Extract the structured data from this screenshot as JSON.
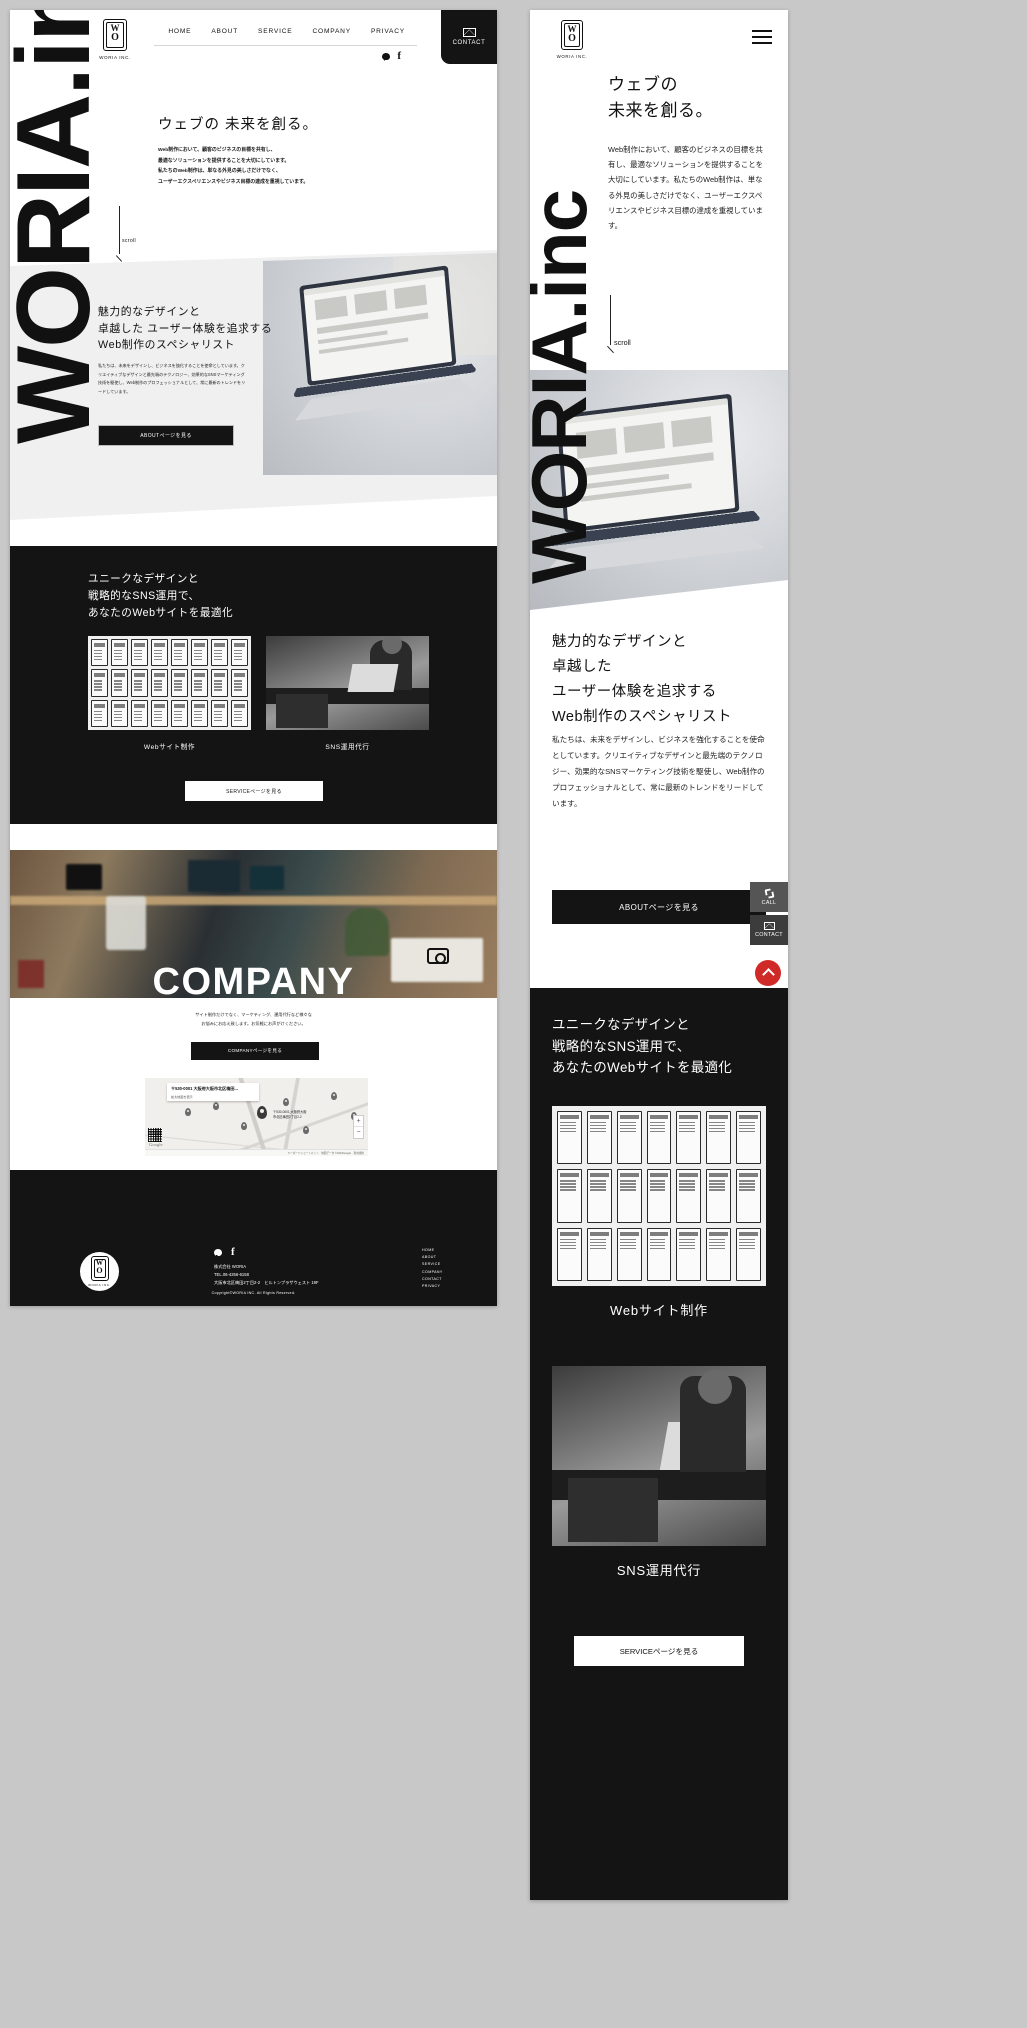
{
  "brand": {
    "wordmark": "WORIA.inc",
    "logo_letters_top": "W",
    "logo_letters_bottom": "O",
    "logo_caption": "WORIA INC."
  },
  "header": {
    "nav": [
      {
        "label": "HOME"
      },
      {
        "label": "ABOUT"
      },
      {
        "label": "SERVICE"
      },
      {
        "label": "COMPANY"
      },
      {
        "label": "PRIVACY"
      }
    ],
    "social": [
      {
        "name": "line-icon"
      },
      {
        "name": "facebook-icon",
        "glyph": "f"
      }
    ],
    "contact_button": "CONTACT",
    "contact_icon": "mail-icon"
  },
  "hero": {
    "title": "ウェブの 未来を創る。",
    "lines": [
      "Web制作において、顧客のビジネスの目標を共有し、",
      "最適なソリューションを提供することを大切にしています。",
      "私たちのWeb制作は、単なる外見の美しさだけでなく、",
      "ユーザーエクスペリエンスやビジネス目標の達成を重視しています。"
    ],
    "scroll_label": "scroll"
  },
  "about": {
    "heading_lines": [
      "魅力的なデザインと",
      "卓越した ユーザー体験を追求する",
      "Web制作のスペシャリスト"
    ],
    "body": "私たちは、未来をデザインし、ビジネスを強化することを使命としています。クリエイティブなデザインと最先端のテクノロジー、効果的なSNSマーケティング技術を駆使し、Web制作のプロフェッショナルとして、常に最新のトレンドをリードしています。",
    "button": "ABOUTページを見る",
    "image_alt": "laptop-on-desk-photo"
  },
  "service": {
    "heading_lines": [
      "ユニークなデザインと",
      "戦略的なSNS運用で、",
      "あなたのWebサイトを最適化"
    ],
    "cards": [
      {
        "caption": "Webサイト制作",
        "image_alt": "wireframe-sketches-photo"
      },
      {
        "caption": "SNS運用代行",
        "image_alt": "person-at-laptop-photo"
      }
    ],
    "button": "SERVICEページを見る"
  },
  "company": {
    "word": "COMPANY",
    "image_alt": "studio-workspace-photo",
    "camera_icon": "camera-icon",
    "lines": [
      "サイト制作だけでなく、マーケティング、運用代行など様々な",
      "お悩みにお応え致します。お気軽にお声がけください。"
    ],
    "button": "COMPANYページを見る"
  },
  "map": {
    "card_title": "〒530-0001 大阪府大阪市北区梅田...",
    "card_sub": "拡大地図を表示",
    "pin_label_line1": "〒530-0001 大阪府大阪",
    "pin_label_line2": "市北区梅田2丁目2-2",
    "zoom_in": "+",
    "zoom_out": "−",
    "attribution": "キーボードショートカット　地図データ ©2023Google　利用規約",
    "google_label": "Google"
  },
  "footer": {
    "social": [
      {
        "name": "line-icon"
      },
      {
        "name": "facebook-icon",
        "glyph": "f"
      }
    ],
    "company_name": "株式会社 WORIA",
    "tel": "TEL.06-4256-6158",
    "address": "大阪市北区梅田2丁目2-2　ヒルトンプラザウェスト 19F",
    "nav": [
      {
        "label": "HOME"
      },
      {
        "label": "ABOUT"
      },
      {
        "label": "SERVICE"
      },
      {
        "label": "COMPANY"
      },
      {
        "label": "CONTACT"
      },
      {
        "label": "PRIVACY"
      }
    ],
    "copyright": "Copyright©WORIA INC. All Rights Reserved."
  },
  "mobile": {
    "menu_icon": "hamburger-menu-icon",
    "hero": {
      "title_lines": [
        "ウェブの",
        "未来を創る。"
      ],
      "body": "Web制作において、顧客のビジネスの目標を共有し、最適なソリューションを提供することを大切にしています。私たちのWeb制作は、単なる外見の美しさだけでなく、ユーザーエクスペリエンスやビジネス目標の達成を重視しています。",
      "scroll_label": "scroll"
    },
    "about": {
      "heading_lines": [
        "魅力的なデザインと",
        "卓越した",
        "ユーザー体験を追求する",
        "Web制作のスペシャリスト"
      ],
      "body": "私たちは、未来をデザインし、ビジネスを強化することを使命としています。クリエイティブなデザインと最先端のテクノロジー、効果的なSNSマーケティング技術を駆使し、Web制作のプロフェッショナルとして、常に最新のトレンドをリードしています。",
      "button": "ABOUTページを見る"
    },
    "fab": {
      "call_label": "CALL",
      "call_icon": "phone-icon",
      "contact_label": "CONTACT",
      "contact_icon": "mail-icon",
      "scroll_top_icon": "chevron-up-icon",
      "scroll_top_color": "#cf2a27"
    },
    "service": {
      "heading_lines": [
        "ユニークなデザインと",
        "戦略的なSNS運用で、",
        "あなたのWebサイトを最適化"
      ],
      "cards": [
        {
          "caption": "Webサイト制作"
        },
        {
          "caption": "SNS運用代行"
        }
      ],
      "button": "SERVICEページを見る"
    }
  },
  "colors": {
    "dark": "#141414",
    "light_band": "#f0f0f0",
    "accent_red": "#cf2a27",
    "page_bg": "#c8c8c8"
  }
}
